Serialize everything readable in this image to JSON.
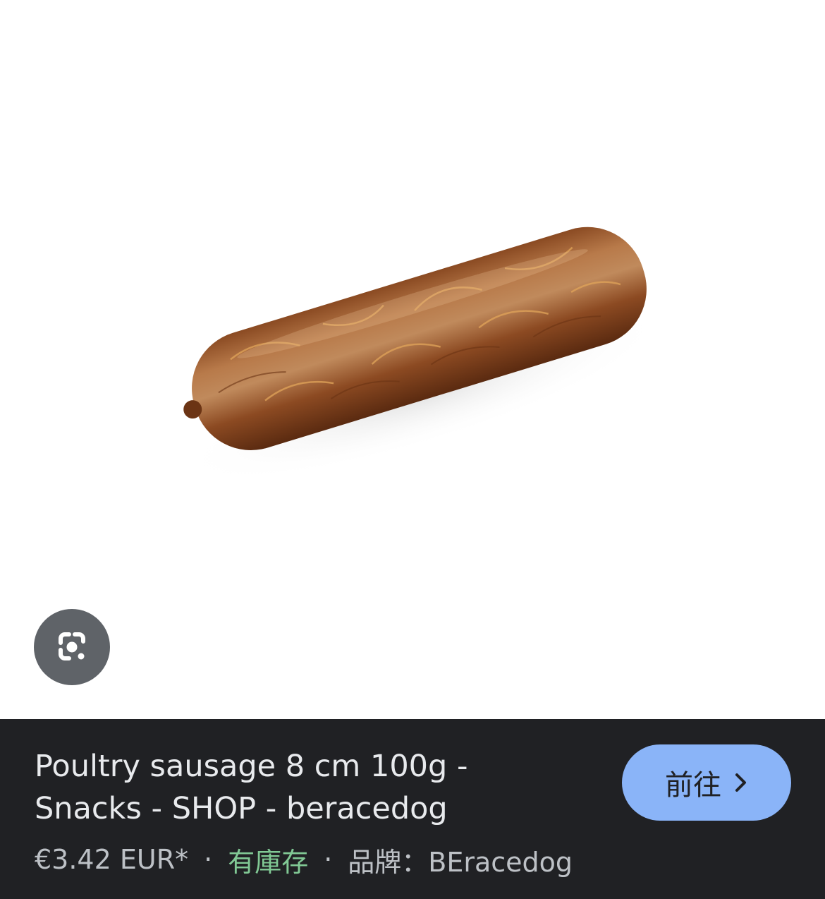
{
  "image": {
    "alt": "Poultry sausage",
    "background": "#ffffff"
  },
  "lens": {
    "icon": "google-lens-icon",
    "color": "#5f6368"
  },
  "product": {
    "title": "Poultry sausage 8 cm 100g - Snacks - SHOP - beracedog",
    "price": "€3.42 EUR*",
    "separator": "·",
    "stock": "有庫存",
    "brand": "品牌：BEracedog"
  },
  "action": {
    "label": "前往",
    "icon": "chevron-right-icon",
    "color": "#8ab4f8"
  },
  "colors": {
    "panel": "#202124",
    "text": "#e8eaed",
    "muted": "#bdc1c6",
    "stock": "#81c995"
  }
}
